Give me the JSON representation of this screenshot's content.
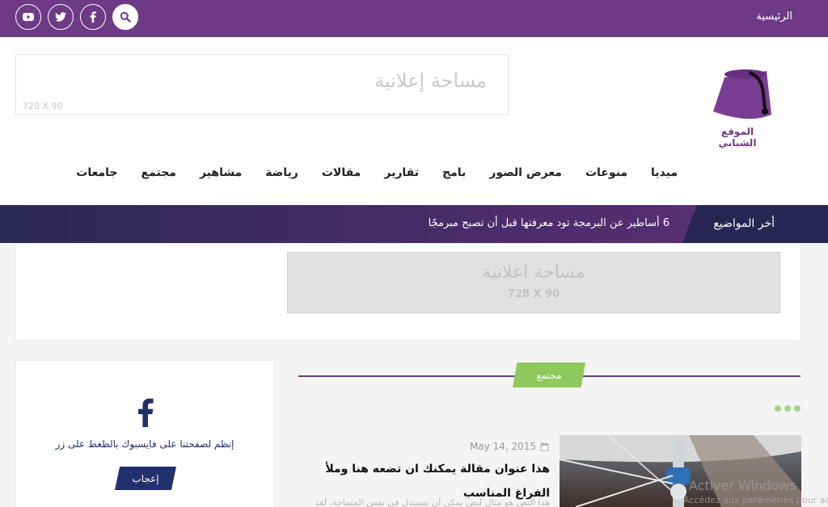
{
  "topbar": {
    "home_label": "الرئيسية",
    "social_icons": [
      "youtube-icon",
      "twitter-icon",
      "facebook-icon",
      "search-icon"
    ],
    "bg_color": "#6e3a86"
  },
  "header": {
    "ad_title": "مساحة إعلانية",
    "ad_size": "728 X 90",
    "logo_text": "الموقع الشبابي"
  },
  "nav": {
    "items": [
      "جامعات",
      "مجتمع",
      "مشاهير",
      "رياضة",
      "مقالات",
      "تقارير",
      "بامج",
      "معرض الصور",
      "منوعات",
      "ميديا"
    ]
  },
  "ticker": {
    "label": "أخر المواضيع",
    "headline": "6 أساطير عن البرمجة تود معرفتها قبل أن تصبح مبرمجًا"
  },
  "ad_box": {
    "title": "مساحة اعلانية",
    "size": "728 X 90"
  },
  "section": {
    "tag": "مجتمع",
    "accent_color": "#8ec95b"
  },
  "fb_widget": {
    "text": "إنظم لصفحتنا على فايسبوك بالظغط على زر",
    "button_label": "إعجاب"
  },
  "article": {
    "date": "May 14, 2015",
    "title": "هذا عنوان مقالة يمكنك ان تضعه هنا وملأ الفراغ المناسب",
    "excerpt": "هذا النص هو مثال لنص يمكن أن يستبدل في نفس المساحة، لقد"
  },
  "watermark": {
    "title": "Activer Windows",
    "subtitle": "Accédez aux paramètres pour ac"
  }
}
